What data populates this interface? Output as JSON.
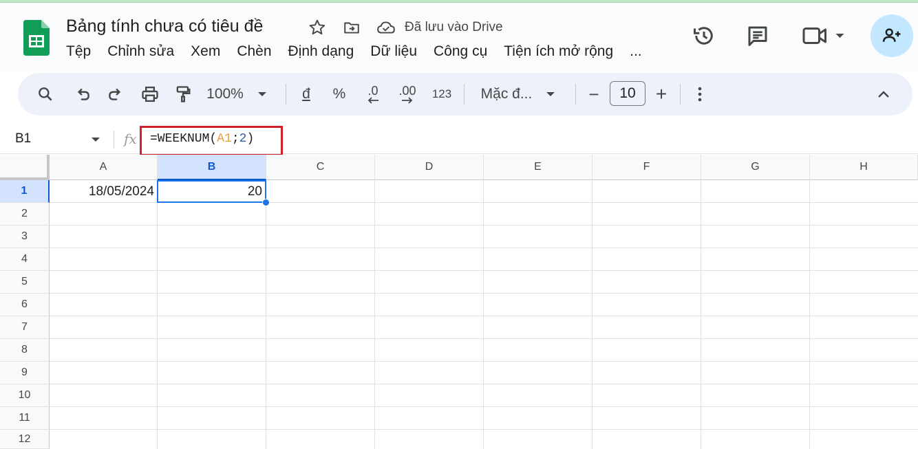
{
  "app": {
    "title": "Bảng tính chưa có tiêu đề",
    "saved_status": "Đã lưu vào Drive",
    "brand_color": "#0f9d58"
  },
  "menu": [
    "Tệp",
    "Chỉnh sửa",
    "Xem",
    "Chèn",
    "Định dạng",
    "Dữ liệu",
    "Công cụ",
    "Tiện ích mở rộng",
    "..."
  ],
  "header_icons": [
    "history-icon",
    "comment-icon",
    "video-icon",
    "share-icon"
  ],
  "toolbar": {
    "zoom": "100%",
    "currency": "đ",
    "percent": "%",
    "decrease_decimal": ".0",
    "increase_decimal": ".00",
    "number_format": "123",
    "font": "Mặc đ...",
    "font_size": "10",
    "minus": "−",
    "plus": "+"
  },
  "formula_bar": {
    "cell_ref": "B1",
    "fx": "fx",
    "formula_prefix": "=WEEKNUM(",
    "formula_ref": "A1",
    "formula_sep": ";",
    "formula_arg": "2",
    "formula_suffix": ")"
  },
  "grid": {
    "columns": [
      "A",
      "B",
      "C",
      "D",
      "E",
      "F",
      "G",
      "H"
    ],
    "rows": [
      "1",
      "2",
      "3",
      "4",
      "5",
      "6",
      "7",
      "8",
      "9",
      "10",
      "11",
      "12"
    ],
    "selected_cell": "B1",
    "cells": {
      "A1": "18/05/2024",
      "B1": "20"
    }
  },
  "colors": {
    "selection": "#1a73e8",
    "highlight_box": "#d0202a",
    "toolbar_bg": "#edf2fa",
    "share_bg": "#c2e7ff"
  }
}
